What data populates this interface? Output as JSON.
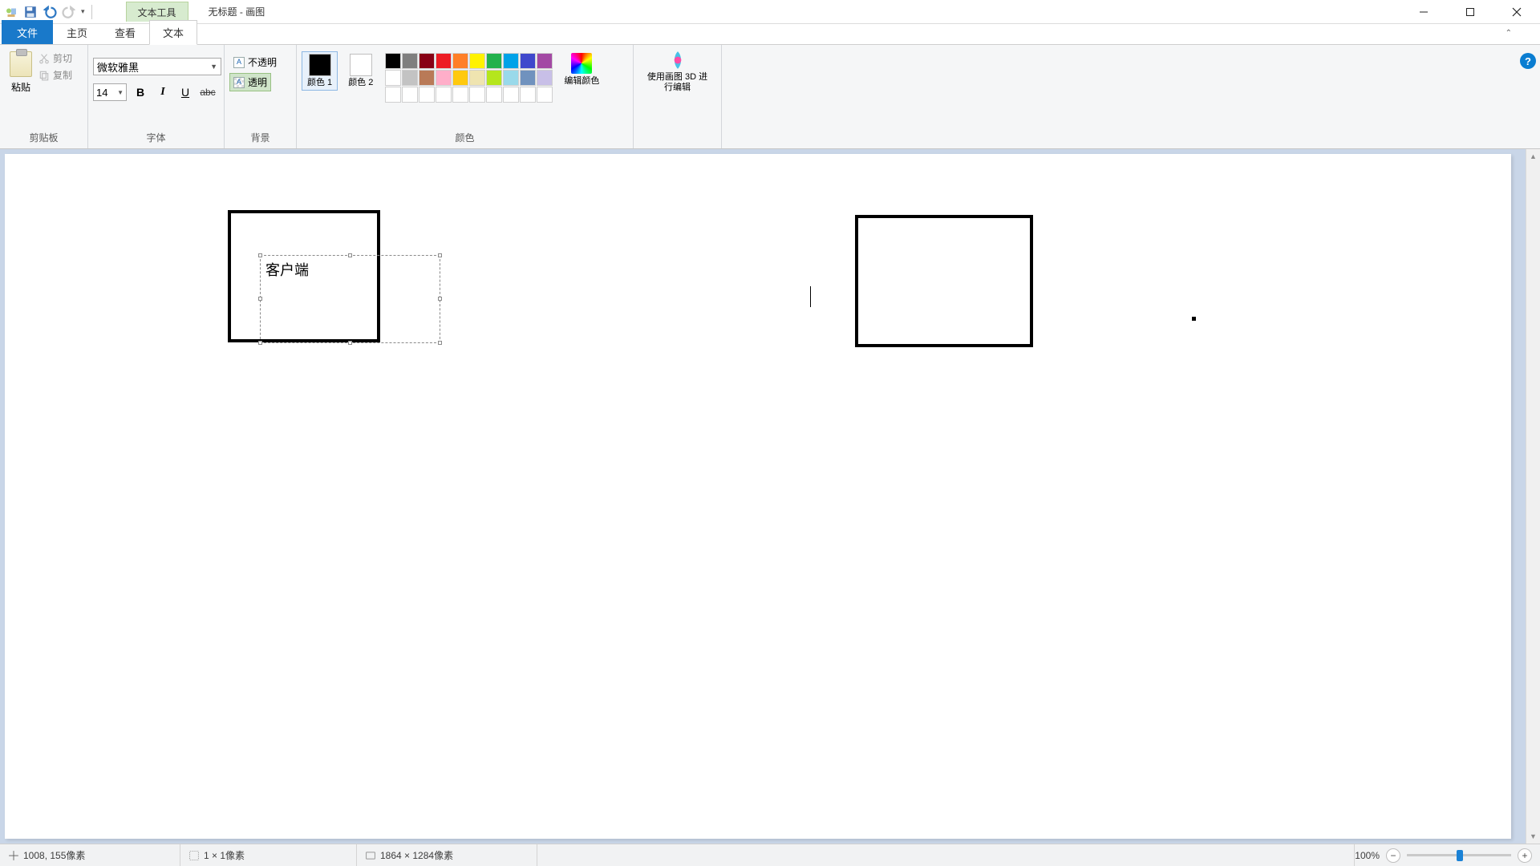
{
  "titlebar": {
    "context_tool_label": "文本工具",
    "document_title": "无标题 - 画图"
  },
  "tabs": {
    "file": "文件",
    "home": "主页",
    "view": "查看",
    "text": "文本"
  },
  "ribbon": {
    "clipboard": {
      "paste": "粘贴",
      "cut": "剪切",
      "copy": "复制",
      "group_label": "剪贴板"
    },
    "font": {
      "family": "微软雅黑",
      "size": "14",
      "group_label": "字体"
    },
    "background": {
      "opaque": "不透明",
      "transparent": "透明",
      "group_label": "背景"
    },
    "colors": {
      "color1_label": "颜色 1",
      "color2_label": "颜色 2",
      "edit_colors": "编辑颜色",
      "paint3d": "使用画图 3D 进行编辑",
      "group_label": "颜色",
      "palette": [
        [
          "#000000",
          "#7f7f7f",
          "#880015",
          "#ed1c24",
          "#ff7f27",
          "#fff200",
          "#22b14c",
          "#00a2e8",
          "#3f48cc",
          "#a349a4"
        ],
        [
          "#ffffff",
          "#c3c3c3",
          "#b97a57",
          "#ffaec9",
          "#ffc90e",
          "#efe4b0",
          "#b5e61d",
          "#99d9ea",
          "#7092be",
          "#c8bfe7"
        ],
        [
          "#ffffff",
          "#ffffff",
          "#ffffff",
          "#ffffff",
          "#ffffff",
          "#ffffff",
          "#ffffff",
          "#ffffff",
          "#ffffff",
          "#ffffff"
        ]
      ]
    }
  },
  "canvas": {
    "textbox_text": "客户端"
  },
  "statusbar": {
    "cursor_pos": "1008, 155像素",
    "selection_size": "1 × 1像素",
    "canvas_size": "1864 × 1284像素",
    "zoom": "100%"
  }
}
